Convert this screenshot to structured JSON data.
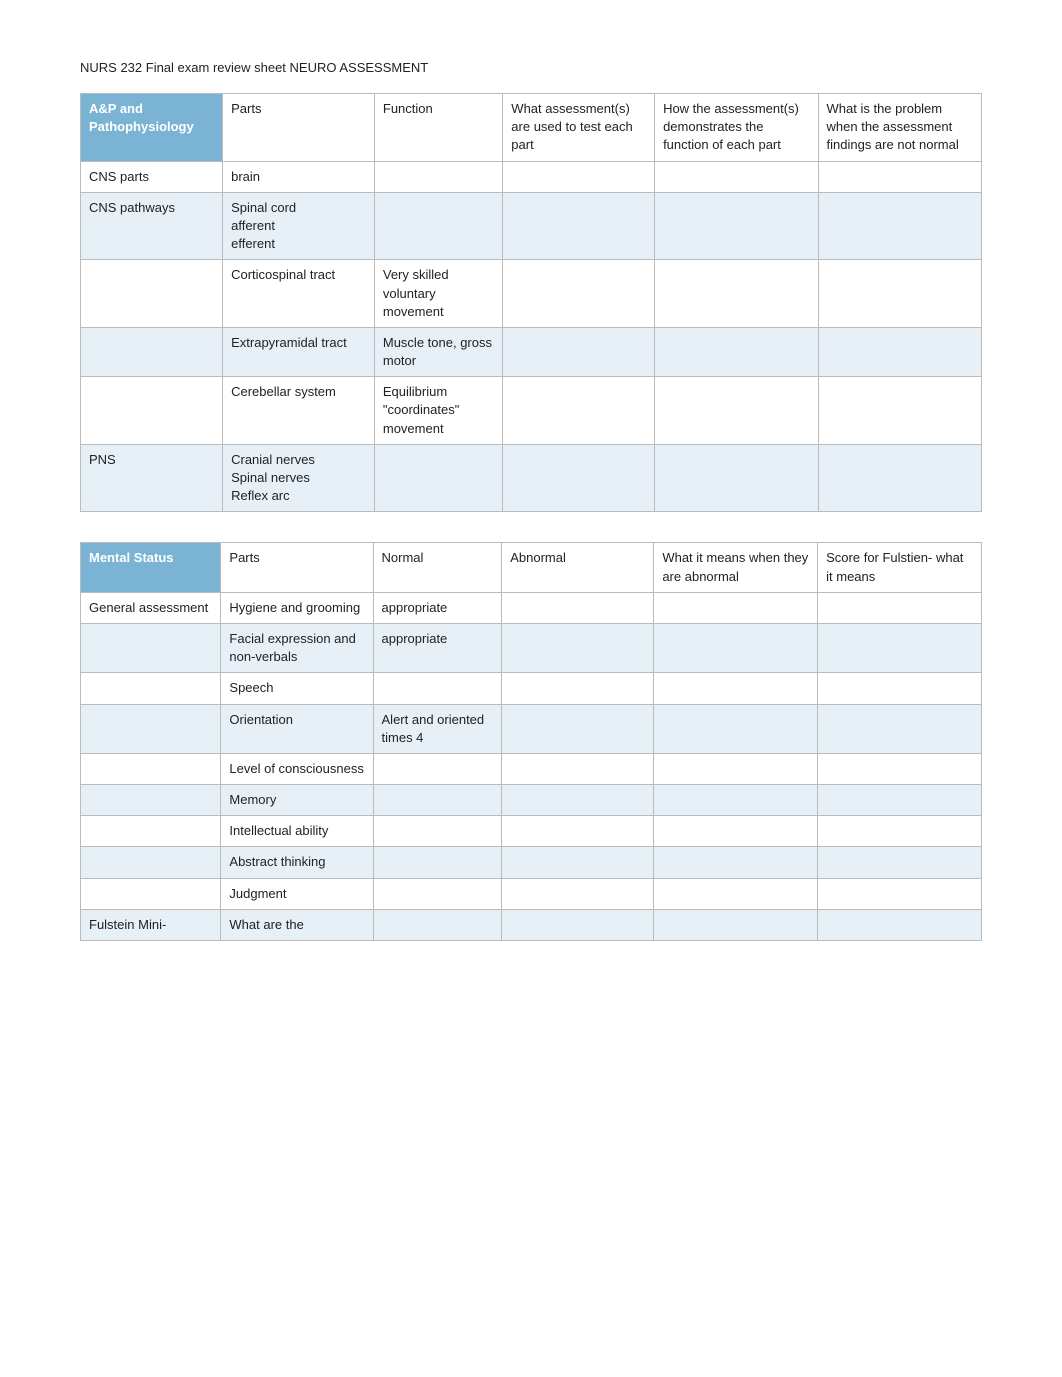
{
  "title": "NURS 232 Final exam review sheet NEURO ASSESSMENT",
  "table1": {
    "headers": [
      "A&P and Pathophysiology",
      "Parts",
      "Function",
      "What assessment(s) are used to test each part",
      "How the assessment(s) demonstrates the function of each part",
      "What is the problem when the assessment findings are not normal"
    ],
    "rows": [
      {
        "col1": "CNS parts",
        "col2": "brain",
        "col3": "",
        "col4": "",
        "col5": "",
        "col6": ""
      },
      {
        "col1": "CNS pathways",
        "col2": "Spinal cord\nafferent\nefferent",
        "col3": "",
        "col4": "",
        "col5": "",
        "col6": ""
      },
      {
        "col1": "",
        "col2": "Corticospinal tract",
        "col3": "Very skilled voluntary movement",
        "col4": "",
        "col5": "",
        "col6": ""
      },
      {
        "col1": "",
        "col2": "Extrapyramidal tract",
        "col3": "Muscle tone, gross motor",
        "col4": "",
        "col5": "",
        "col6": ""
      },
      {
        "col1": "",
        "col2": "Cerebellar system",
        "col3": "Equilibrium \"coordinates\" movement",
        "col4": "",
        "col5": "",
        "col6": ""
      },
      {
        "col1": "PNS",
        "col2": "Cranial nerves\nSpinal nerves\nReflex arc",
        "col3": "",
        "col4": "",
        "col5": "",
        "col6": ""
      }
    ]
  },
  "table2": {
    "headers": [
      "Mental Status",
      "Parts",
      "Normal",
      "Abnormal",
      "What it means when they are abnormal",
      "Score for Fulstien- what it means"
    ],
    "rows": [
      {
        "col1": "General assessment",
        "col2": "Hygiene and grooming",
        "col3": "appropriate",
        "col4": "",
        "col5": "",
        "col6": ""
      },
      {
        "col1": "",
        "col2": "Facial expression and non-verbals",
        "col3": "appropriate",
        "col4": "",
        "col5": "",
        "col6": ""
      },
      {
        "col1": "",
        "col2": "Speech",
        "col3": "",
        "col4": "",
        "col5": "",
        "col6": ""
      },
      {
        "col1": "",
        "col2": "Orientation",
        "col3": "Alert and oriented times 4",
        "col4": "",
        "col5": "",
        "col6": ""
      },
      {
        "col1": "",
        "col2": "Level of consciousness",
        "col3": "",
        "col4": "",
        "col5": "",
        "col6": ""
      },
      {
        "col1": "",
        "col2": "Memory",
        "col3": "",
        "col4": "",
        "col5": "",
        "col6": ""
      },
      {
        "col1": "",
        "col2": "Intellectual ability",
        "col3": "",
        "col4": "",
        "col5": "",
        "col6": ""
      },
      {
        "col1": "",
        "col2": "Abstract thinking",
        "col3": "",
        "col4": "",
        "col5": "",
        "col6": ""
      },
      {
        "col1": "",
        "col2": "Judgment",
        "col3": "",
        "col4": "",
        "col5": "",
        "col6": ""
      },
      {
        "col1": "Fulstein Mini-",
        "col2": "What are the",
        "col3": "",
        "col4": "",
        "col5": "",
        "col6": ""
      }
    ]
  }
}
